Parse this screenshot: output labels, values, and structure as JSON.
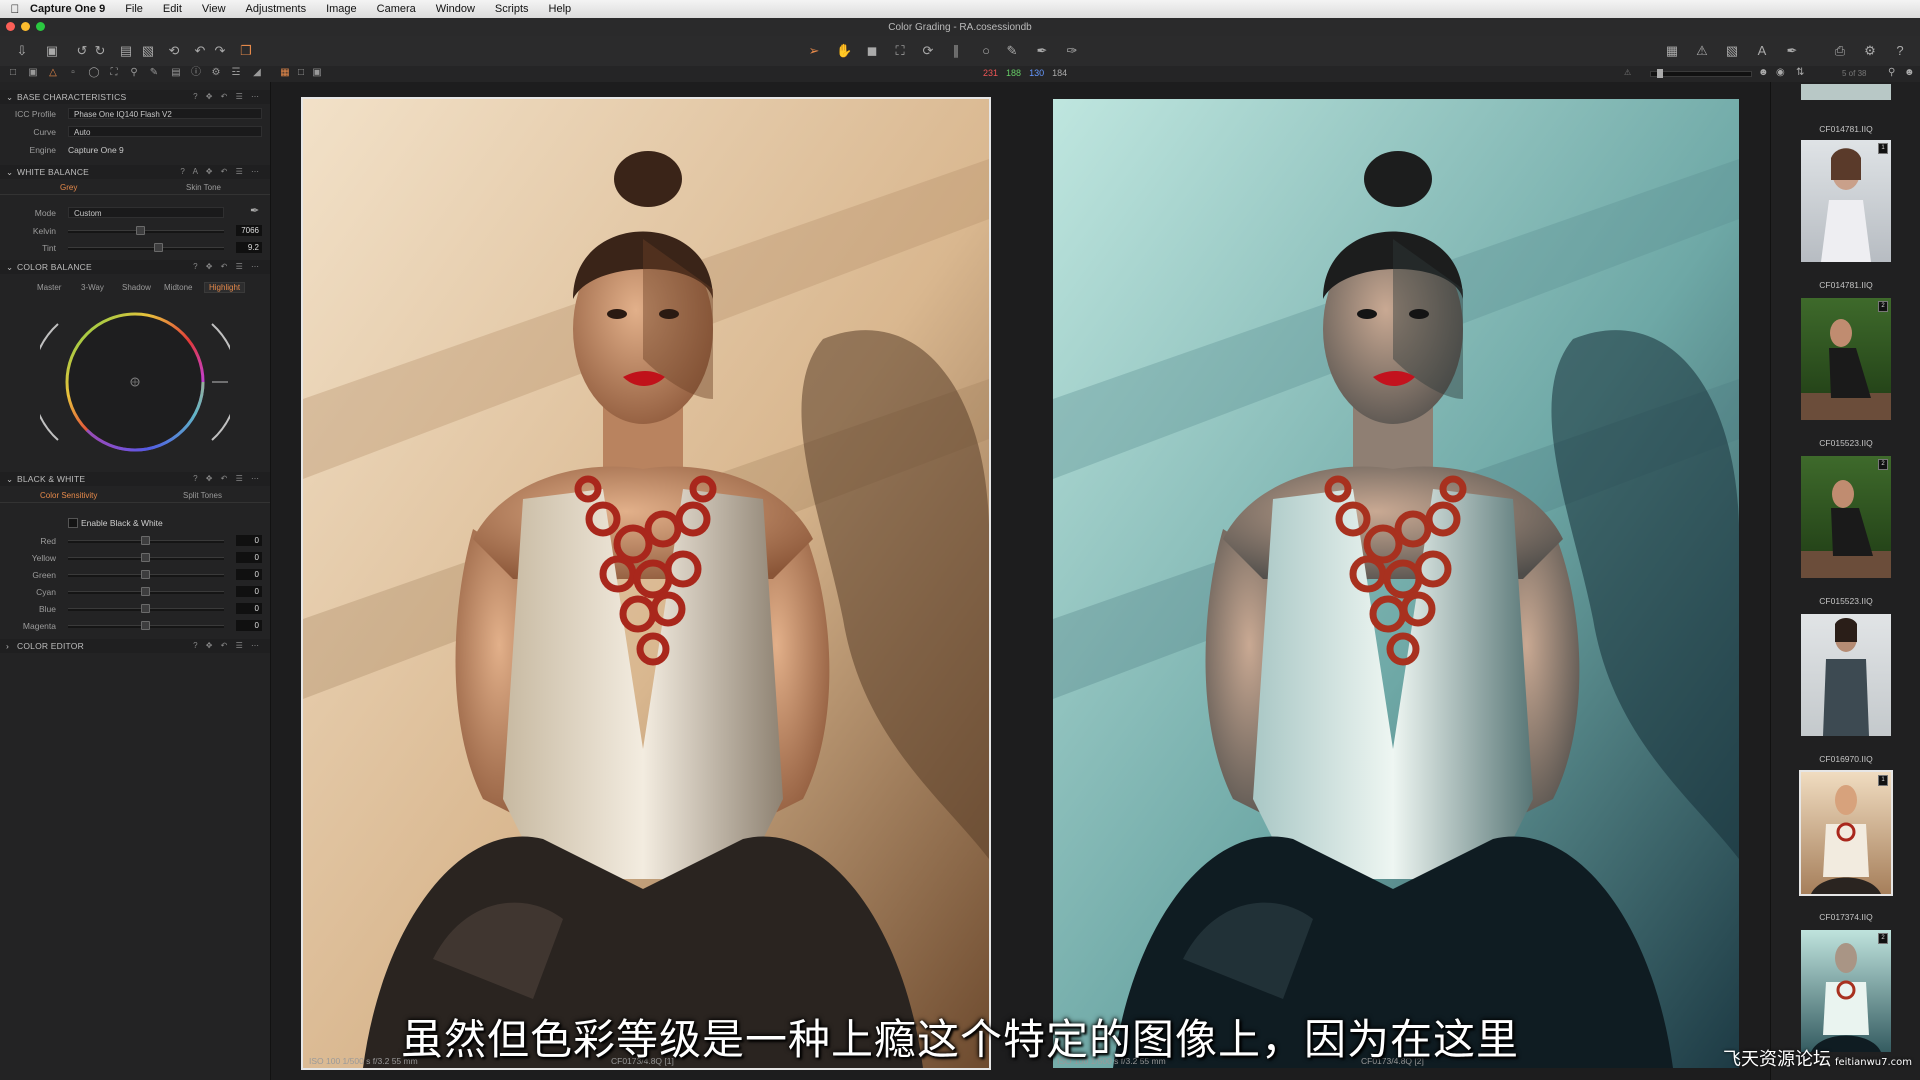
{
  "menubar": {
    "app": "Capture One 9",
    "items": [
      "File",
      "Edit",
      "View",
      "Adjustments",
      "Image",
      "Camera",
      "Window",
      "Scripts",
      "Help"
    ]
  },
  "titlebar": {
    "title": "Color Grading - RA.cosessiondb"
  },
  "tabrow": {
    "rgb": [
      "231",
      "188",
      "130",
      "184"
    ],
    "page_counter": "5 of 38"
  },
  "panels": {
    "base": {
      "title": "BASE CHARACTERISTICS",
      "icc_label": "ICC Profile",
      "icc_value": "Phase One IQ140 Flash V2",
      "curve_label": "Curve",
      "curve_value": "Auto",
      "engine_label": "Engine",
      "engine_value": "Capture One 9"
    },
    "white_balance": {
      "title": "WHITE BALANCE",
      "tab_grey": "Grey",
      "tab_skin": "Skin Tone",
      "mode_label": "Mode",
      "mode_value": "Custom",
      "kelvin_label": "Kelvin",
      "kelvin_value": "7066",
      "tint_label": "Tint",
      "tint_value": "9.2"
    },
    "color_balance": {
      "title": "COLOR BALANCE",
      "tabs": [
        "Master",
        "3-Way",
        "Shadow",
        "Midtone",
        "Highlight"
      ],
      "active_tab": "Highlight"
    },
    "black_white": {
      "title": "BLACK & WHITE",
      "tab_sensitivity": "Color Sensitivity",
      "tab_split": "Split Tones",
      "enable_label": "Enable Black & White",
      "sliders": [
        {
          "label": "Red",
          "value": "0"
        },
        {
          "label": "Yellow",
          "value": "0"
        },
        {
          "label": "Green",
          "value": "0"
        },
        {
          "label": "Cyan",
          "value": "0"
        },
        {
          "label": "Blue",
          "value": "0"
        },
        {
          "label": "Magenta",
          "value": "0"
        }
      ]
    },
    "color_editor": {
      "title": "COLOR EDITOR"
    }
  },
  "viewer": {
    "left_meta": "ISO 100    1/500 s    f/3.2    55 mm",
    "left_name": "CF0173/4.8Q [1]",
    "right_meta": "ISO 100    1/500 s    f/3.2    55 mm",
    "right_name": "CF0173/4.8Q [2]"
  },
  "filmstrip": {
    "thumbs": [
      {
        "name": "CF014781.IIQ",
        "badge": "3"
      },
      {
        "name": "CF014781.IIQ",
        "badge": "1"
      },
      {
        "name": "CF015523.IIQ",
        "badge": "2"
      },
      {
        "name": "CF015523.IIQ",
        "badge": "2"
      },
      {
        "name": "CF016970.IIQ",
        "badge": ""
      },
      {
        "name": "CF017374.IIQ",
        "badge": "1"
      },
      {
        "name": "CF017374.IIQ",
        "badge": "2"
      }
    ]
  },
  "subtitle": "虽然但色彩等级是一种上瘾这个特定的图像上，因为在这里",
  "watermark": {
    "cn": "飞天资源论坛",
    "url": "feitianwu7.com"
  }
}
